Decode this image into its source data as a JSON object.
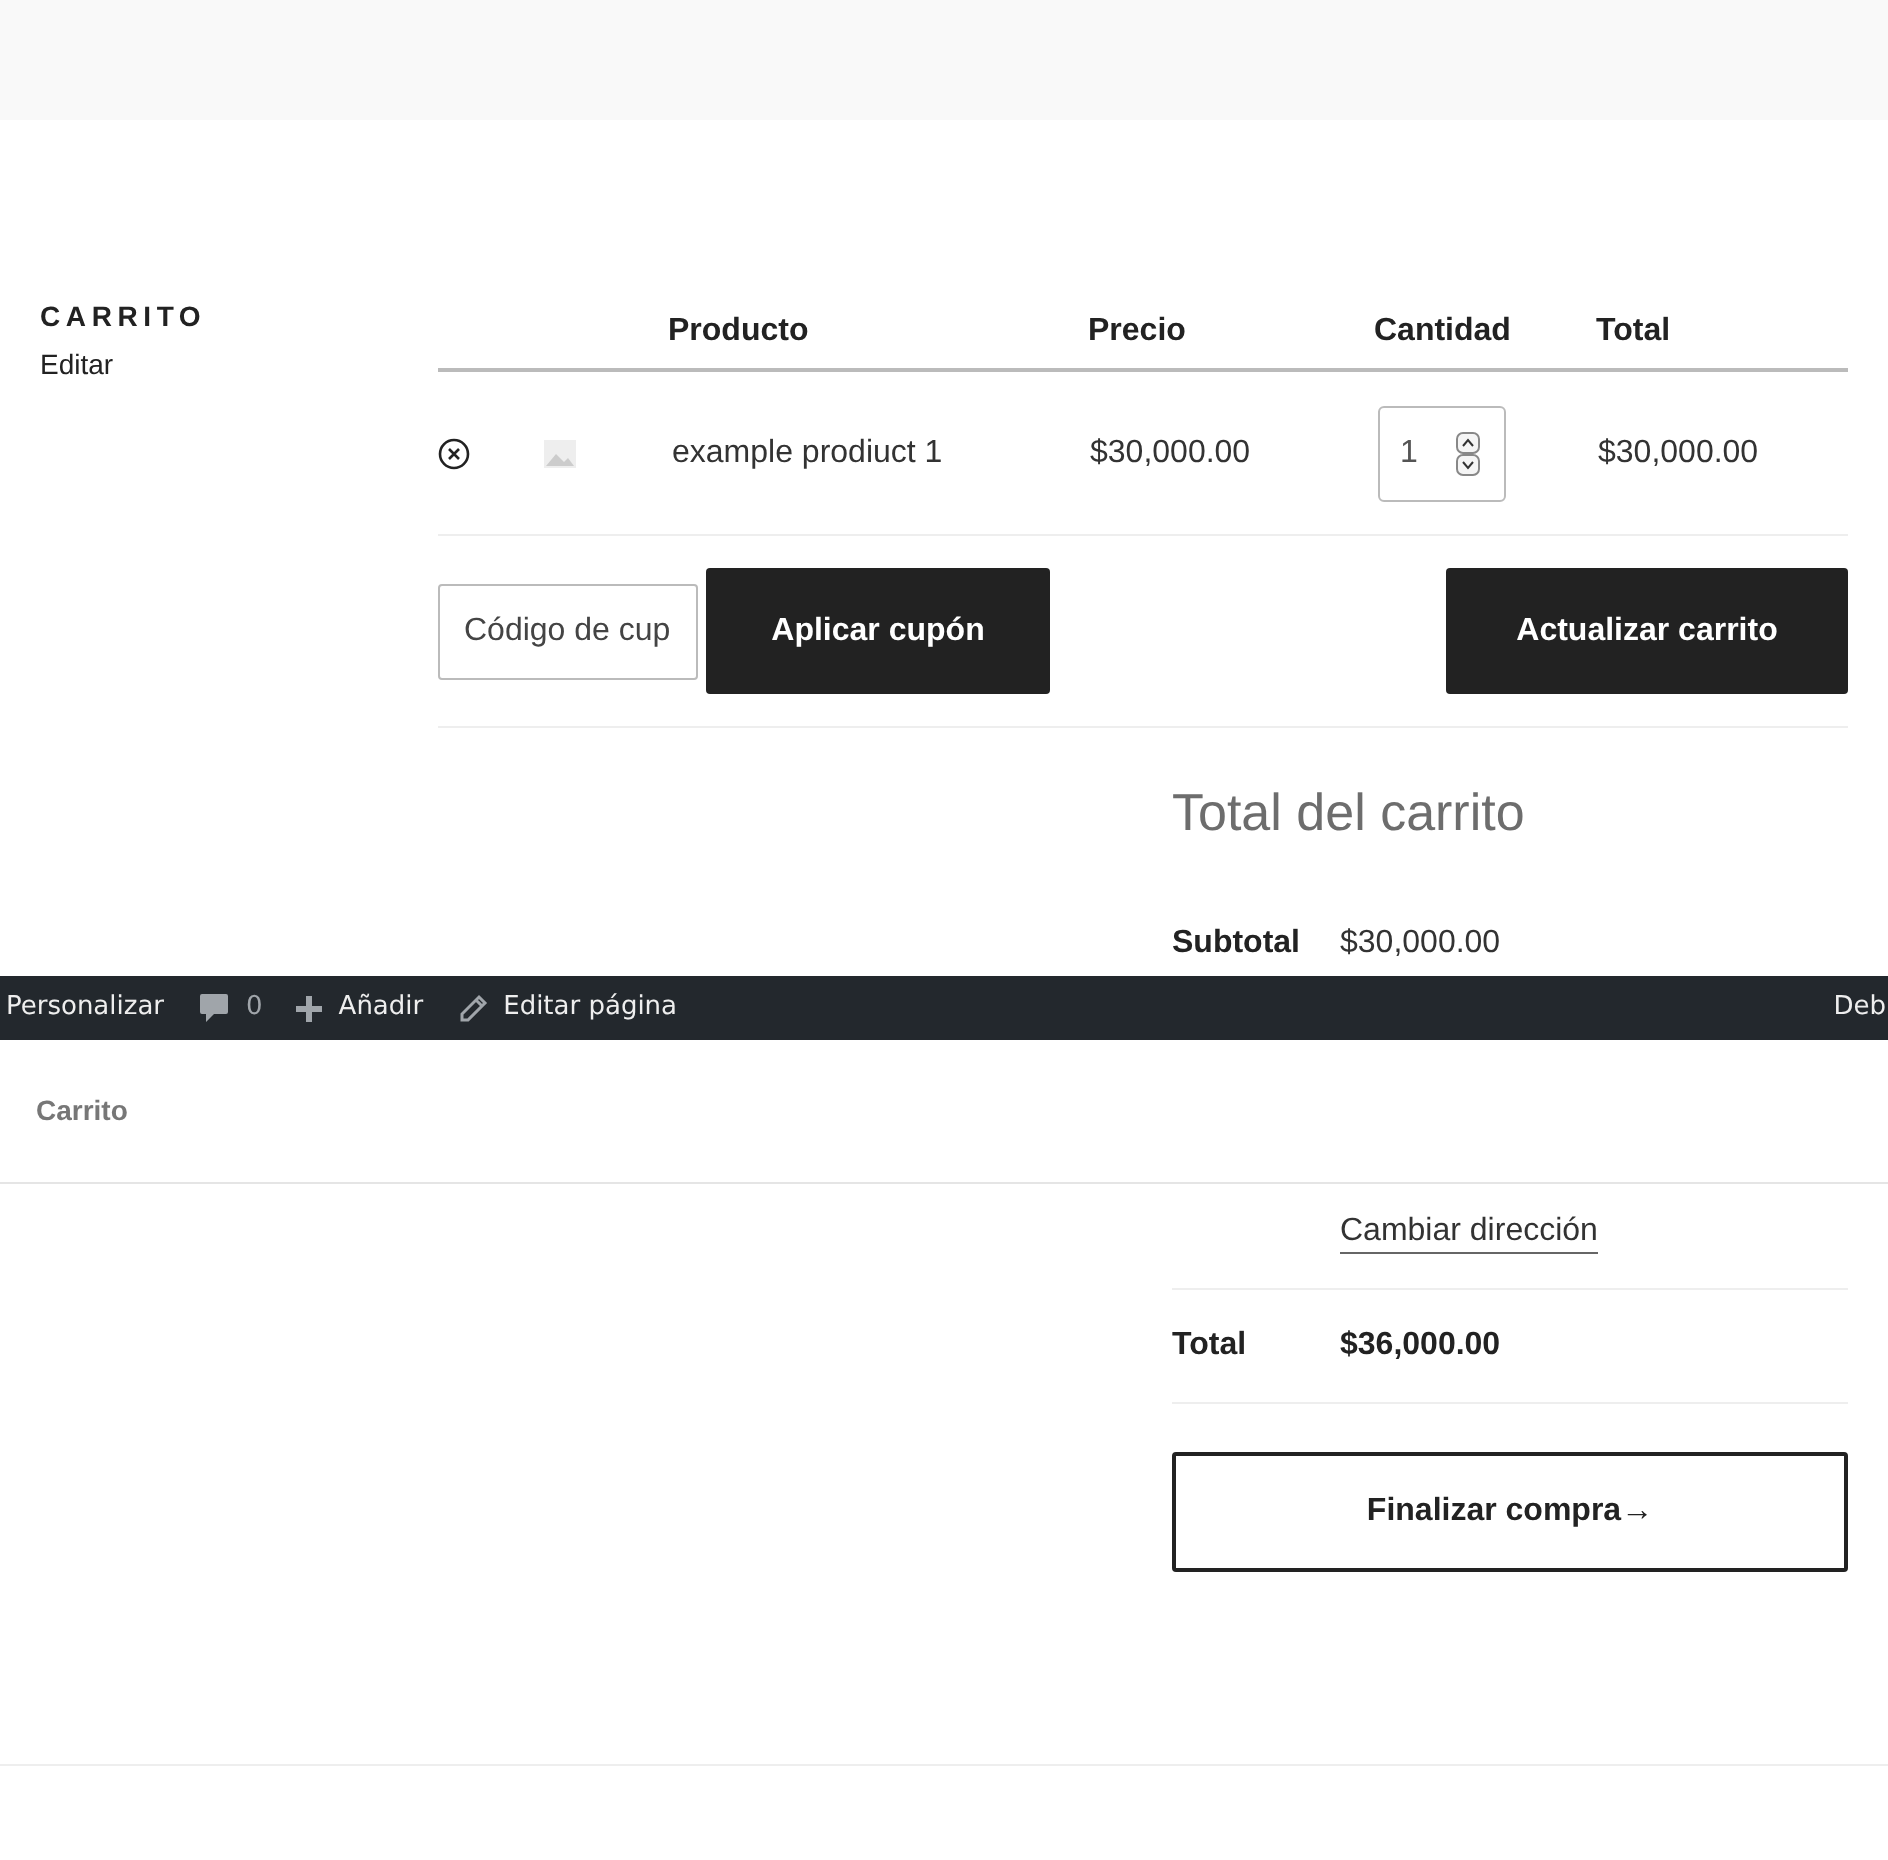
{
  "page_header": {
    "heading": "CARRITO",
    "edit_link": "Editar"
  },
  "cart_table": {
    "columns": [
      "Producto",
      "Precio",
      "Cantidad",
      "Total"
    ],
    "rows": [
      {
        "product": "example prodiuct 1",
        "price": "$30,000.00",
        "quantity": "1",
        "total": "$30,000.00"
      }
    ]
  },
  "coupon": {
    "placeholder": "Código de cup",
    "button": "Aplicar cupón"
  },
  "update_button": "Actualizar carrito",
  "cart_totals": {
    "title": "Total del carrito",
    "subtotal_label": "Subtotal",
    "subtotal": "$30,000.00",
    "change_address": "Cambiar dirección",
    "total_label": "Total",
    "total": "$36,000.00",
    "checkout_button": "Finalizar compra→"
  },
  "admin_bar": {
    "items": [
      {
        "kind": "text",
        "label": "Personalizar"
      },
      {
        "kind": "comments",
        "label": "0"
      },
      {
        "kind": "new",
        "label": "Añadir"
      },
      {
        "kind": "edit",
        "label": "Editar página"
      }
    ],
    "right_item": "Deb"
  },
  "sticky_header": {
    "title": "Carrito"
  }
}
